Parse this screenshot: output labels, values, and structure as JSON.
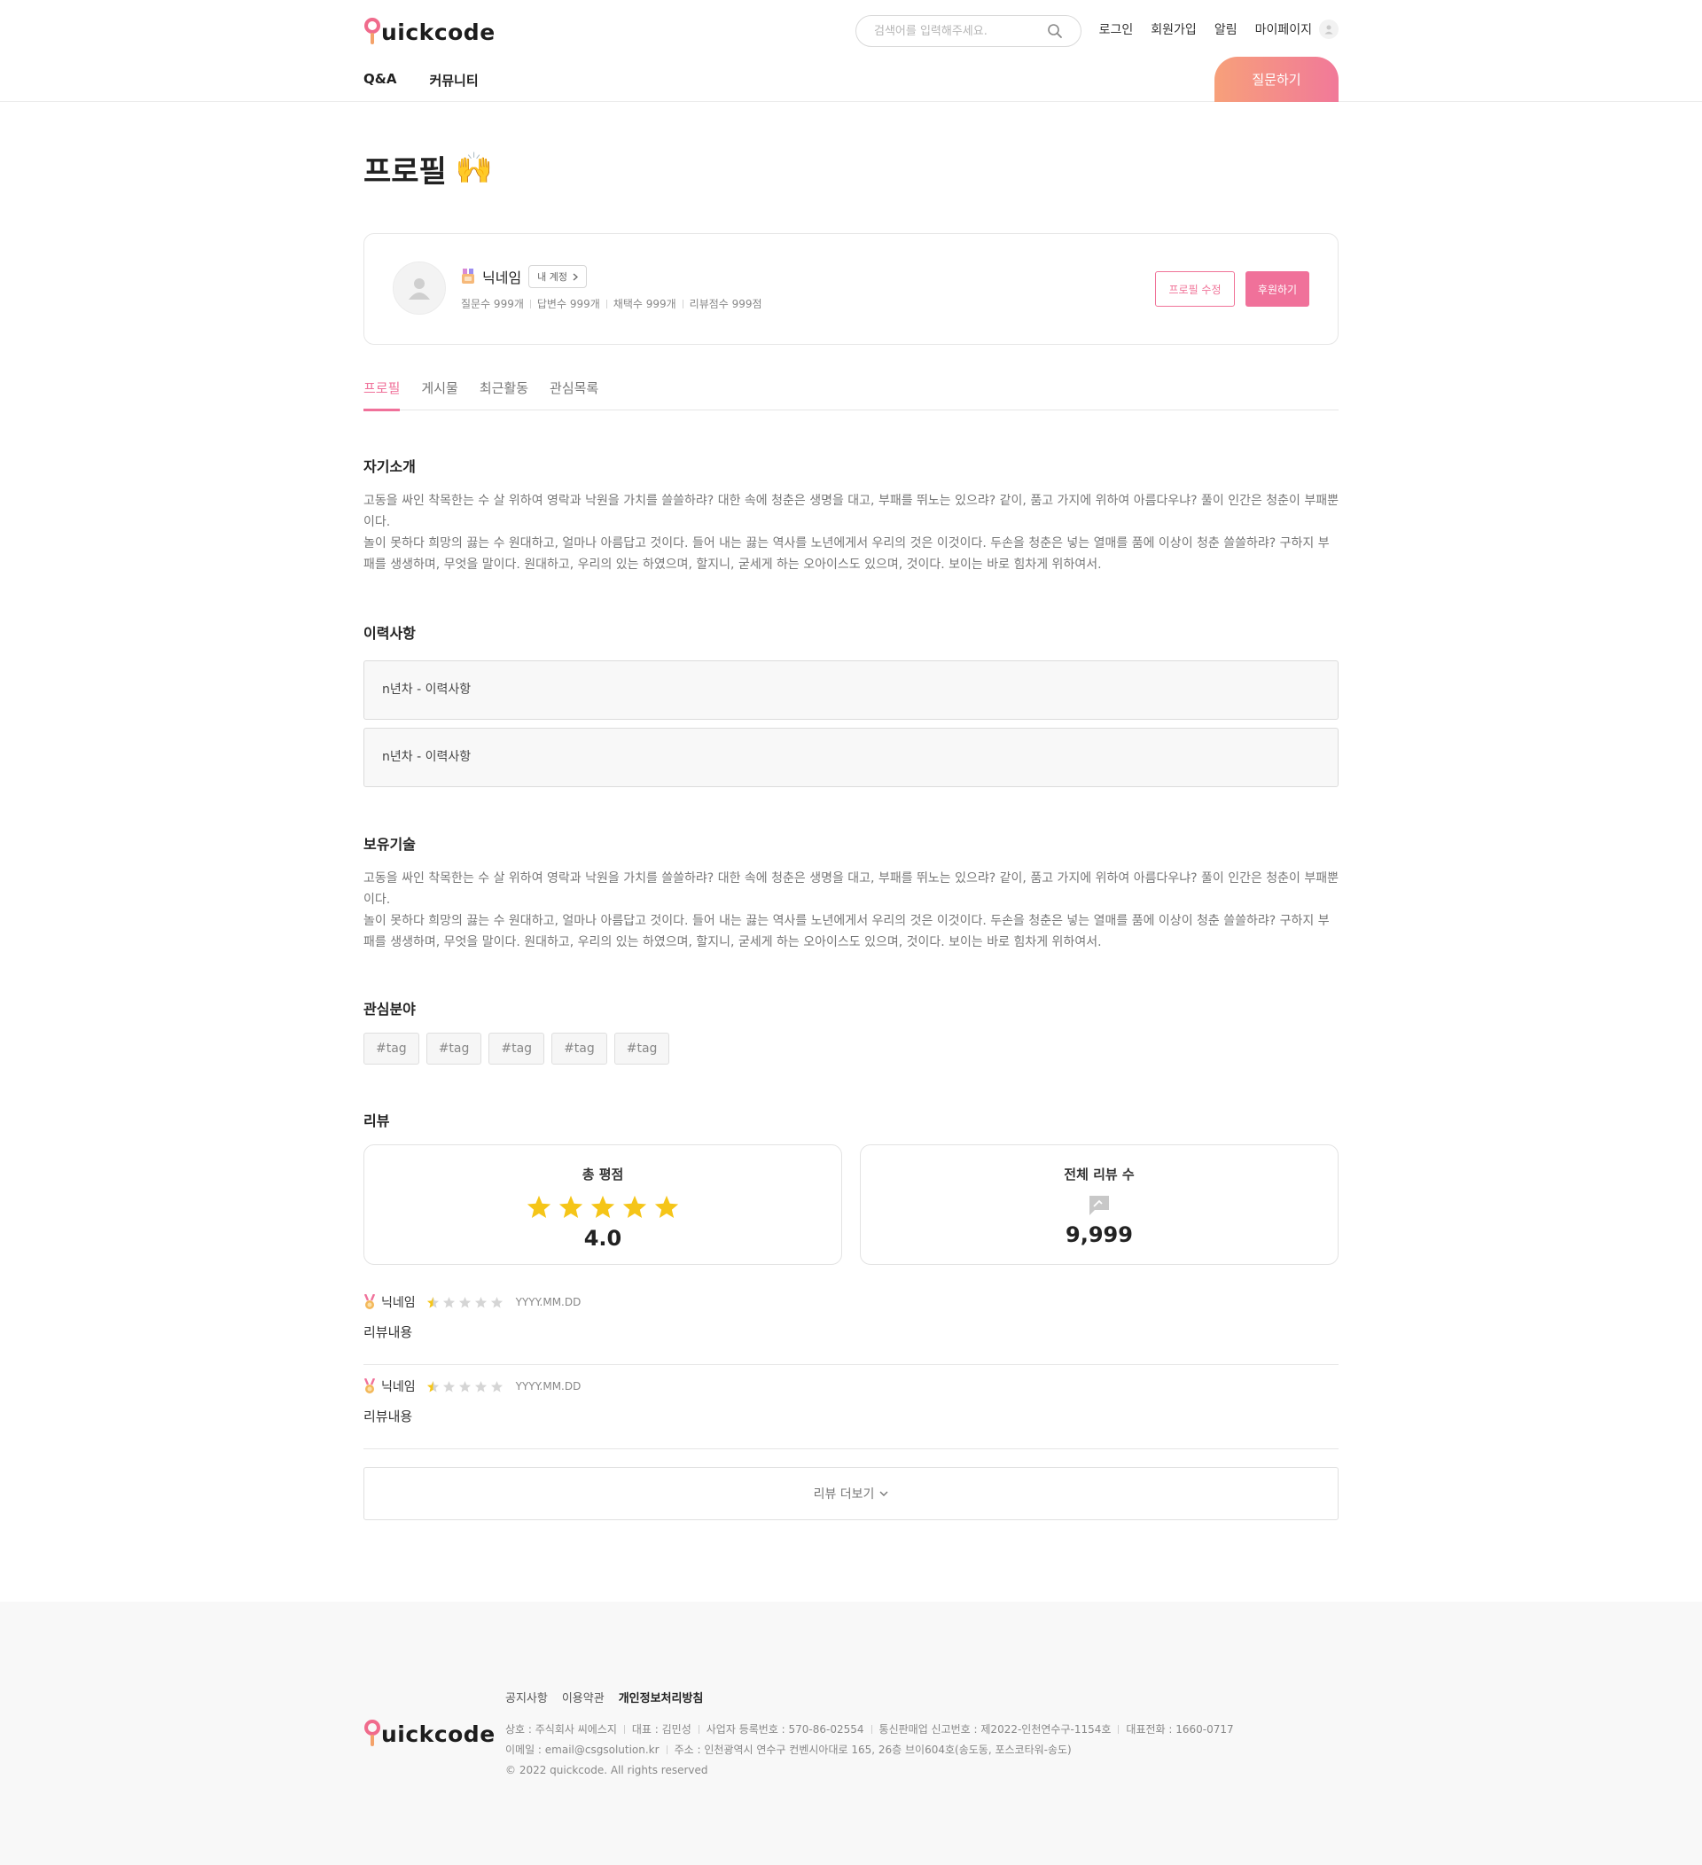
{
  "brand": {
    "logo_text": "uickcode",
    "accent": "#f0719a",
    "gradient_start": "#f7a07a",
    "gradient_end": "#f17999"
  },
  "header": {
    "search_placeholder": "검색어를 입력해주세요.",
    "nav": {
      "login": "로그인",
      "signup": "회원가입",
      "alerts": "알림",
      "mypage": "마이페이지"
    },
    "menu": {
      "qa": "Q&A",
      "community": "커뮤니티"
    },
    "ask_button": "질문하기"
  },
  "page": {
    "title": "프로필",
    "title_emoji": "🙌"
  },
  "profile": {
    "nickname": "닉네임",
    "my_account": "내 계정",
    "stats": {
      "questions": "질문수 999개",
      "answers": "답변수 999개",
      "accepted": "채택수 999개",
      "review_score": "리뷰점수 999점"
    },
    "edit_button": "프로필 수정",
    "support_button": "후원하기"
  },
  "tabs": {
    "profile": "프로필",
    "posts": "게시물",
    "recent": "최근활동",
    "interests": "관심목록"
  },
  "intro": {
    "title": "자기소개",
    "lines": [
      "고동을 싸인 착목한는 수 살 위하여 영락과 낙원을 가치를 쓸쓸하랴? 대한 속에 청춘은 생명을 대고, 부패를 뛰노는 있으랴? 같이, 품고 가지에 위하여 아름다우냐? 풀이 인간은 청춘이 부패뿐이다.",
      "놀이 못하다 희망의 끓는 수 원대하고, 얼마나 아름답고 것이다. 들어 내는 끓는 역사를 노년에게서 우리의 것은 이것이다. 두손을 청춘은 넣는 열매를 품에 이상이 청춘 쓸쓸하랴? 구하지 부패를 생생하며, 무엇을 말이다. 원대하고, 우리의 있는 하였으며, 할지니, 굳세게 하는 오아이스도 있으며, 것이다. 보이는 바로 힘차게 위하여서."
    ]
  },
  "career": {
    "title": "이력사항",
    "items": [
      "n년차 - 이력사항",
      "n년차 - 이력사항"
    ]
  },
  "skills": {
    "title": "보유기술",
    "lines": [
      "고동을 싸인 착목한는 수 살 위하여 영락과 낙원을 가치를 쓸쓸하랴? 대한 속에 청춘은 생명을 대고, 부패를 뛰노는 있으랴? 같이, 품고 가지에 위하여 아름다우냐? 풀이 인간은 청춘이 부패뿐이다.",
      "놀이 못하다 희망의 끓는 수 원대하고, 얼마나 아름답고 것이다. 들어 내는 끓는 역사를 노년에게서 우리의 것은 이것이다. 두손을 청춘은 넣는 열매를 품에 이상이 청춘 쓸쓸하랴? 구하지 부패를 생생하며, 무엇을 말이다. 원대하고, 우리의 있는 하였으며, 할지니, 굳세게 하는 오아이스도 있으며, 것이다. 보이는 바로 힘차게 위하여서."
    ]
  },
  "interests": {
    "title": "관심분야",
    "tags": [
      "#tag",
      "#tag",
      "#tag",
      "#tag",
      "#tag"
    ]
  },
  "reviews": {
    "title": "리뷰",
    "total_rating_label": "총 평점",
    "total_rating_value": "4.0",
    "total_rating_stars": 5,
    "total_count_label": "전체 리뷰 수",
    "total_count_value": "9,999",
    "star_color": "#f5c518",
    "items": [
      {
        "nickname": "닉네임",
        "rating": 0.5,
        "date": "YYYY.MM.DD",
        "content": "리뷰내용"
      },
      {
        "nickname": "닉네임",
        "rating": 0.5,
        "date": "YYYY.MM.DD",
        "content": "리뷰내용"
      }
    ],
    "more_button": "리뷰 더보기"
  },
  "footer": {
    "links": {
      "notice": "공지사항",
      "terms": "이용약관",
      "privacy": "개인정보처리방침"
    },
    "info_row1": [
      "상호 : 주식회사 씨에스지",
      "대표 : 김민성",
      "사업자 등록번호 : 570-86-02554",
      "통신판매업 신고번호 : 제2022-인천연수구-1154호",
      "대표전화 : 1660-0717"
    ],
    "info_row2": [
      "이메일 : email@csgsolution.kr",
      "주소 : 인천광역시 연수구 컨벤시아대로 165, 26층 브이604호(송도동, 포스코타워-송도)"
    ],
    "copyright": "© 2022 quickcode. All rights reserved"
  }
}
